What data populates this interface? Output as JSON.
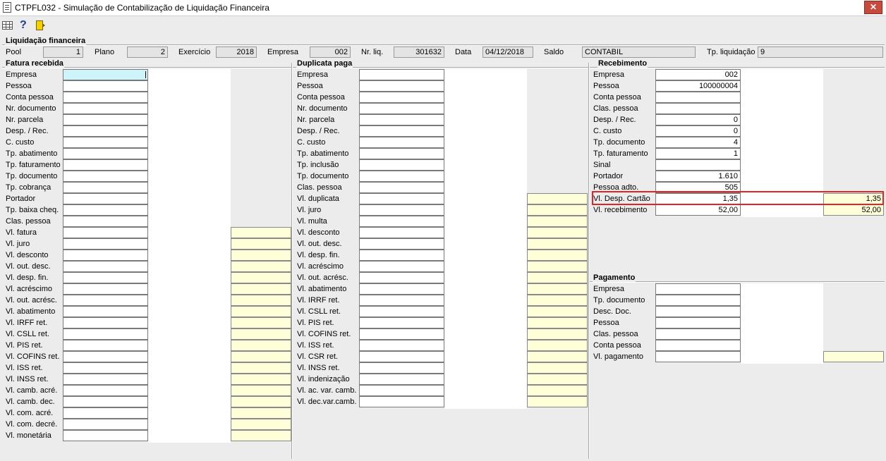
{
  "window": {
    "title": "CTPFL032 - Simulação de Contabilização de Liquidação Financeira",
    "close_label": "✕"
  },
  "toolbar": {
    "help_label": "?"
  },
  "liquidacao": {
    "title": "Liquidação financeira",
    "pool_label": "Pool",
    "pool": "1",
    "plano_label": "Plano",
    "plano": "2",
    "exercicio_label": "Exercício",
    "exercicio": "2018",
    "empresa_label": "Empresa",
    "empresa": "002",
    "nrliq_label": "Nr. liq.",
    "nrliq": "301632",
    "data_label": "Data",
    "data": "04/12/2018",
    "saldo_label": "Saldo",
    "saldo": "CONTABIL",
    "tpliq_label": "Tp. liquidação",
    "tpliq": "9"
  },
  "fatura": {
    "title": "Fatura recebida",
    "rows": [
      {
        "label": "Empresa",
        "value": "",
        "yel": false
      },
      {
        "label": "Pessoa",
        "value": "",
        "yel": false
      },
      {
        "label": "Conta pessoa",
        "value": "",
        "yel": false
      },
      {
        "label": "Nr. documento",
        "value": "",
        "yel": false
      },
      {
        "label": "Nr. parcela",
        "value": "",
        "yel": false
      },
      {
        "label": "Desp. / Rec.",
        "value": "",
        "yel": false
      },
      {
        "label": "C. custo",
        "value": "",
        "yel": false
      },
      {
        "label": "Tp. abatimento",
        "value": "",
        "yel": false
      },
      {
        "label": "Tp. faturamento",
        "value": "",
        "yel": false
      },
      {
        "label": "Tp. documento",
        "value": "",
        "yel": false
      },
      {
        "label": "Tp. cobrança",
        "value": "",
        "yel": false
      },
      {
        "label": "Portador",
        "value": "",
        "yel": false
      },
      {
        "label": "Tp. baixa cheq.",
        "value": "",
        "yel": false
      },
      {
        "label": "Clas. pessoa",
        "value": "",
        "yel": false
      },
      {
        "label": "Vl. fatura",
        "value": "",
        "yel": true
      },
      {
        "label": "Vl. juro",
        "value": "",
        "yel": true
      },
      {
        "label": "Vl. desconto",
        "value": "",
        "yel": true
      },
      {
        "label": "Vl. out. desc.",
        "value": "",
        "yel": true
      },
      {
        "label": "Vl. desp. fin.",
        "value": "",
        "yel": true
      },
      {
        "label": "Vl. acréscimo",
        "value": "",
        "yel": true
      },
      {
        "label": "Vl. out. acrésc.",
        "value": "",
        "yel": true
      },
      {
        "label": "Vl. abatimento",
        "value": "",
        "yel": true
      },
      {
        "label": "Vl. IRFF ret.",
        "value": "",
        "yel": true
      },
      {
        "label": "Vl. CSLL ret.",
        "value": "",
        "yel": true
      },
      {
        "label": "Vl. PIS ret.",
        "value": "",
        "yel": true
      },
      {
        "label": "Vl. COFINS ret.",
        "value": "",
        "yel": true
      },
      {
        "label": "Vl. ISS ret.",
        "value": "",
        "yel": true
      },
      {
        "label": "Vl. INSS ret.",
        "value": "",
        "yel": true
      },
      {
        "label": "Vl. camb. acré.",
        "value": "",
        "yel": true
      },
      {
        "label": "Vl. camb. dec.",
        "value": "",
        "yel": true
      },
      {
        "label": "Vl. com. acré.",
        "value": "",
        "yel": true
      },
      {
        "label": "Vl. com. decré.",
        "value": "",
        "yel": true
      },
      {
        "label": "Vl. monetária",
        "value": "",
        "yel": true
      }
    ]
  },
  "duplicata": {
    "title": "Duplicata paga",
    "rows": [
      {
        "label": "Empresa",
        "yel": false
      },
      {
        "label": "Pessoa",
        "yel": false
      },
      {
        "label": "Conta pessoa",
        "yel": false
      },
      {
        "label": "Nr. documento",
        "yel": false
      },
      {
        "label": "Nr. parcela",
        "yel": false
      },
      {
        "label": "Desp. / Rec.",
        "yel": false
      },
      {
        "label": "C. custo",
        "yel": false
      },
      {
        "label": "Tp. abatimento",
        "yel": false
      },
      {
        "label": "Tp. inclusão",
        "yel": false
      },
      {
        "label": "Tp. documento",
        "yel": false
      },
      {
        "label": "Clas. pessoa",
        "yel": false
      },
      {
        "label": "Vl. duplicata",
        "yel": true
      },
      {
        "label": "Vl. juro",
        "yel": true
      },
      {
        "label": "Vl. multa",
        "yel": true
      },
      {
        "label": "Vl. desconto",
        "yel": true
      },
      {
        "label": "Vl. out. desc.",
        "yel": true
      },
      {
        "label": "Vl. desp. fin.",
        "yel": true
      },
      {
        "label": "Vl. acréscimo",
        "yel": true
      },
      {
        "label": "Vl. out. acrésc.",
        "yel": true
      },
      {
        "label": "Vl. abatimento",
        "yel": true
      },
      {
        "label": "Vl. IRRF ret.",
        "yel": true
      },
      {
        "label": "Vl. CSLL ret.",
        "yel": true
      },
      {
        "label": "Vl. PIS ret.",
        "yel": true
      },
      {
        "label": "Vl. COFINS ret.",
        "yel": true
      },
      {
        "label": "Vl. ISS ret.",
        "yel": true
      },
      {
        "label": "Vl. CSR ret.",
        "yel": true
      },
      {
        "label": "Vl. INSS ret.",
        "yel": true
      },
      {
        "label": "Vl. indenização",
        "yel": true
      },
      {
        "label": "Vl. ac. var. camb.",
        "yel": true
      },
      {
        "label": "Vl. dec.var.camb.",
        "yel": true
      }
    ]
  },
  "recebimento": {
    "title": "Recebimento",
    "rows": [
      {
        "label": "Empresa",
        "value": "002",
        "extra": null
      },
      {
        "label": "Pessoa",
        "value": "100000004",
        "extra": null
      },
      {
        "label": "Conta pessoa",
        "value": "",
        "extra": null
      },
      {
        "label": "Clas. pessoa",
        "value": "",
        "extra": null
      },
      {
        "label": "Desp. / Rec.",
        "value": "0",
        "extra": null
      },
      {
        "label": "C. custo",
        "value": "0",
        "extra": null
      },
      {
        "label": "Tp. documento",
        "value": "4",
        "extra": null
      },
      {
        "label": "Tp. faturamento",
        "value": "1",
        "extra": null
      },
      {
        "label": "Sinal",
        "value": "",
        "extra": null
      },
      {
        "label": "Portador",
        "value": "1.610",
        "extra": null
      },
      {
        "label": "Pessoa adto.",
        "value": "505",
        "extra": null
      },
      {
        "label": "Vl. Desp. Cartão",
        "value": "1,35",
        "extra": "1,35"
      },
      {
        "label": "Vl. recebimento",
        "value": "52,00",
        "extra": "52,00"
      }
    ]
  },
  "pagamento": {
    "title": "Pagamento",
    "rows": [
      {
        "label": "Empresa",
        "value": "",
        "extra": null
      },
      {
        "label": "Tp. documento",
        "value": "",
        "extra": null
      },
      {
        "label": "Desc. Doc.",
        "value": "",
        "extra": null
      },
      {
        "label": "Pessoa",
        "value": "",
        "extra": null
      },
      {
        "label": "Clas. pessoa",
        "value": "",
        "extra": null
      },
      {
        "label": "Conta pessoa",
        "value": "",
        "extra": null
      },
      {
        "label": "Vl. pagamento",
        "value": "",
        "extra": ""
      }
    ]
  }
}
